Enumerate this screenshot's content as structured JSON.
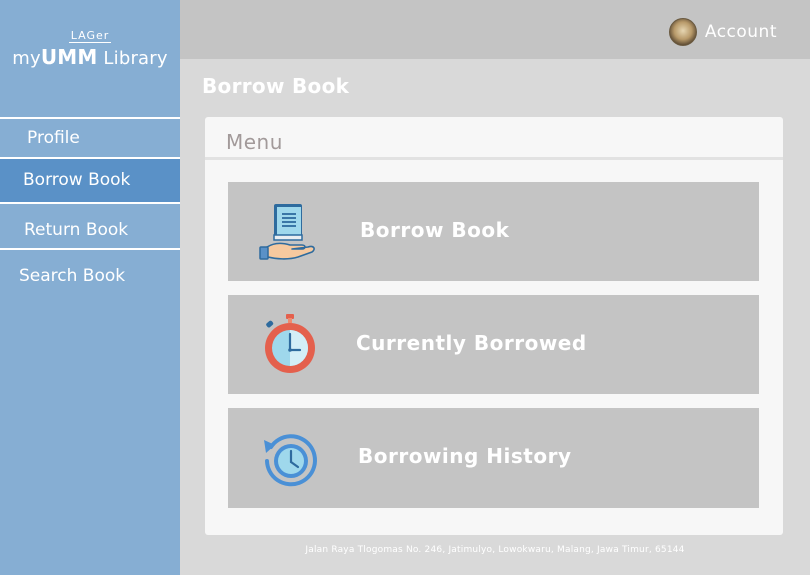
{
  "sidebar": {
    "logo_small": "LAGer",
    "logo_prefix": "my",
    "logo_bold": "UMM",
    "logo_suffix": " Library",
    "items": [
      {
        "label": "Profile"
      },
      {
        "label": "Borrow Book",
        "active": true
      },
      {
        "label": "Return Book"
      },
      {
        "label": "Search Book"
      }
    ]
  },
  "header": {
    "account_label": "Account"
  },
  "main": {
    "title": "Borrow Book",
    "menu_title": "Menu",
    "cards": [
      {
        "label": "Borrow Book",
        "icon": "book-hand-icon"
      },
      {
        "label": "Currently Borrowed",
        "icon": "stopwatch-icon"
      },
      {
        "label": "Borrowing History",
        "icon": "history-clock-icon"
      }
    ]
  },
  "footer": {
    "address": "Jalan Raya Tlogomas No. 246, Jatimulyo, Lowokwaru, Malang, Jawa Timur, 65144"
  },
  "colors": {
    "sidebar": "#86aed3",
    "sidebar_active": "#5a91c7",
    "topbar": "#c4c4c4",
    "content_bg": "#d9d9d9",
    "card": "#c4c4c4",
    "panel": "#f7f7f7"
  }
}
